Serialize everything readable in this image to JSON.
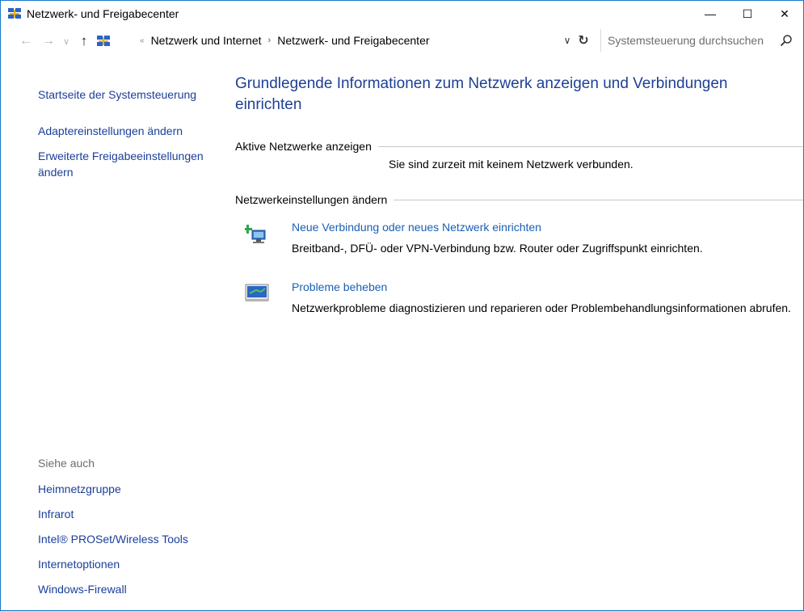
{
  "window": {
    "title": "Netzwerk- und Freigabecenter",
    "controls": {
      "minimize": "—",
      "maximize": "☐",
      "close": "✕"
    }
  },
  "navigation": {
    "back": "←",
    "forward": "→",
    "recent": "∨",
    "up": "↑",
    "overflow": "«",
    "breadcrumb": [
      "Netzwerk und Internet",
      "Netzwerk- und Freigabecenter"
    ],
    "separator": "›",
    "dropdown": "∨",
    "refresh": "↻"
  },
  "search": {
    "placeholder": "Systemsteuerung durchsuchen",
    "icon": "search-icon"
  },
  "sidebar": {
    "links": [
      {
        "label": "Startseite der Systemsteuerung"
      },
      {
        "label": "Adaptereinstellungen ändern"
      },
      {
        "label": "Erweiterte Freigabeeinstellungen ändern"
      }
    ],
    "see_also_title": "Siehe auch",
    "see_also": [
      {
        "label": "Heimnetzgruppe"
      },
      {
        "label": "Infrarot"
      },
      {
        "label": "Intel® PROSet/Wireless Tools"
      },
      {
        "label": "Internetoptionen"
      },
      {
        "label": "Windows-Firewall"
      }
    ]
  },
  "main": {
    "heading": "Grundlegende Informationen zum Netzwerk anzeigen und Verbindungen einrichten",
    "active_networks": {
      "label": "Aktive Netzwerke anzeigen",
      "status": "Sie sind zurzeit mit keinem Netzwerk verbunden."
    },
    "change_settings": {
      "label": "Netzwerkeinstellungen ändern",
      "tasks": [
        {
          "icon": "new-connection-icon",
          "link": "Neue Verbindung oder neues Netzwerk einrichten",
          "description": "Breitband-, DFÜ- oder VPN-Verbindung bzw. Router oder Zugriffspunkt einrichten."
        },
        {
          "icon": "troubleshoot-icon",
          "link": "Probleme beheben",
          "description": "Netzwerkprobleme diagnostizieren und reparieren oder Problembehandlungsinformationen abrufen."
        }
      ]
    }
  },
  "colors": {
    "window_border": "#1979ca",
    "heading": "#1e3f93",
    "link": "#1a3e9a",
    "task_link": "#1a5fb4",
    "muted": "#6d6d6d"
  }
}
